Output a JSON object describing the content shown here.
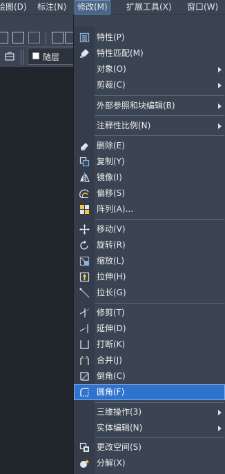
{
  "menubar": {
    "items": [
      {
        "label": "绘图(D)",
        "active": false
      },
      {
        "label": "标注(N)",
        "active": false
      },
      {
        "label": "修改(M)",
        "active": true
      },
      {
        "label": "扩展工具(X)",
        "active": false
      },
      {
        "label": "窗口(W)",
        "active": false
      }
    ]
  },
  "toolbar": {
    "layer_label": "随层"
  },
  "menu": {
    "items": [
      {
        "label": "特性(P)",
        "icon": "properties-icon"
      },
      {
        "label": "特性匹配(M)",
        "icon": "match-properties-icon"
      },
      {
        "label": "对象(O)",
        "submenu": true
      },
      {
        "label": "剪裁(C)",
        "submenu": true
      },
      {
        "label": "外部参照和块编辑(B)",
        "submenu": true
      },
      {
        "label": "注释性比例(N)",
        "submenu": true
      },
      {
        "label": "删除(E)",
        "icon": "erase-icon"
      },
      {
        "label": "复制(Y)",
        "icon": "copy-icon"
      },
      {
        "label": "镜像(I)",
        "icon": "mirror-icon"
      },
      {
        "label": "偏移(S)",
        "icon": "offset-icon"
      },
      {
        "label": "阵列(A)...",
        "icon": "array-icon"
      },
      {
        "label": "移动(V)",
        "icon": "move-icon"
      },
      {
        "label": "旋转(R)",
        "icon": "rotate-icon"
      },
      {
        "label": "缩放(L)",
        "icon": "scale-icon"
      },
      {
        "label": "拉伸(H)",
        "icon": "stretch-icon"
      },
      {
        "label": "拉长(G)",
        "icon": "lengthen-icon"
      },
      {
        "label": "修剪(T)",
        "icon": "trim-icon"
      },
      {
        "label": "延伸(D)",
        "icon": "extend-icon"
      },
      {
        "label": "打断(K)",
        "icon": "break-icon"
      },
      {
        "label": "合并(J)",
        "icon": "join-icon"
      },
      {
        "label": "倒角(C)",
        "icon": "chamfer-icon"
      },
      {
        "label": "圆角(F)",
        "icon": "fillet-icon",
        "highlighted": true
      },
      {
        "label": "三维操作(3)",
        "submenu": true
      },
      {
        "label": "实体编辑(N)",
        "submenu": true
      },
      {
        "label": "更改空间(S)",
        "icon": "change-space-icon"
      },
      {
        "label": "分解(X)",
        "icon": "explode-icon"
      }
    ]
  },
  "colors": {
    "background": "#3b4453",
    "highlight": "#2f73cf",
    "canvas": "#21262d"
  }
}
